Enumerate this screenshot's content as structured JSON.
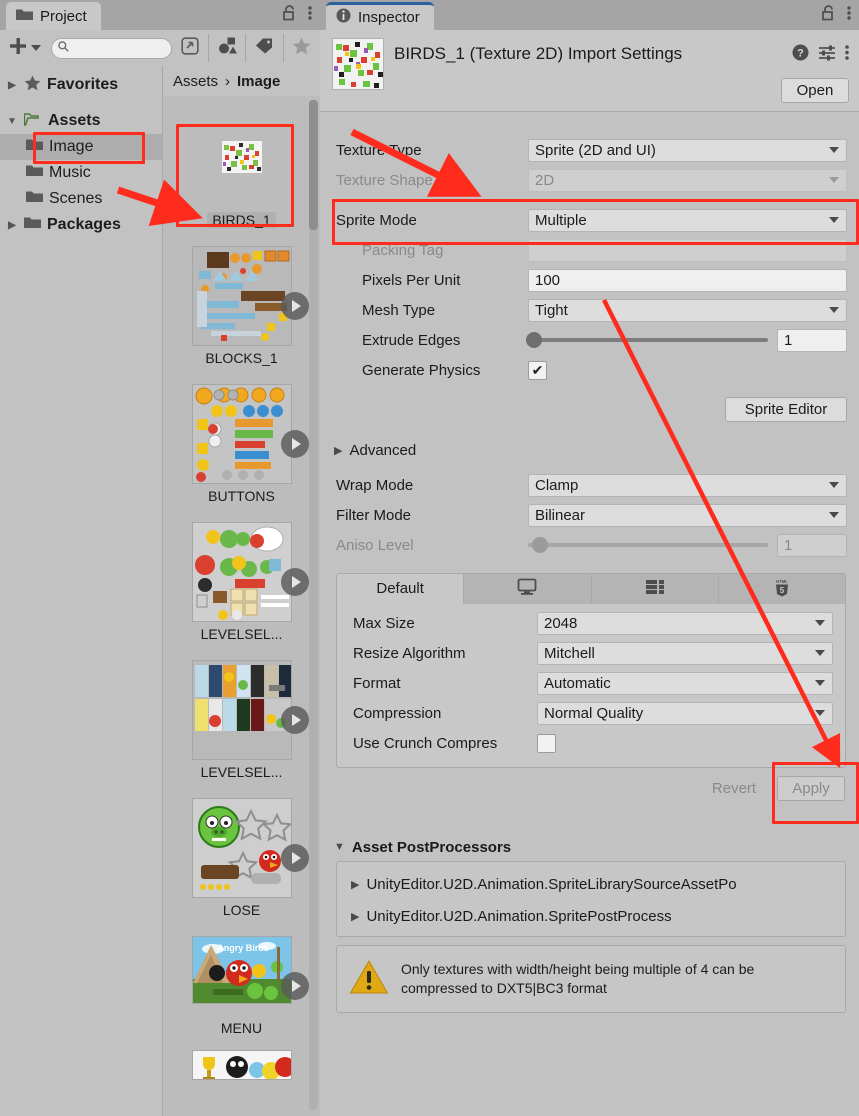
{
  "project_panel": {
    "tab_label": "Project",
    "tab_icon": "folder-icon",
    "lock_icon": "lock-open-icon",
    "menu_icon": "kebab-menu-icon",
    "toolbar": {
      "add_label": "+",
      "add_dropdown_icon": "chevron-down-icon",
      "search_placeholder": "",
      "search_value": "",
      "search_icon": "search-icon",
      "expand_icon": "expand-window-icon",
      "filter_type_icon": "shapes-filter-icon",
      "filter_label_icon": "tag-icon",
      "favorite_icon": "star-icon"
    },
    "tree": [
      {
        "label": "Favorites",
        "icon": "star-icon",
        "arrow": "▶",
        "depth": 0,
        "bold": true,
        "selected": false
      },
      {
        "label": "Assets",
        "icon": "folder-open-icon",
        "arrow": "▼",
        "depth": 0,
        "bold": true,
        "selected": false
      },
      {
        "label": "Image",
        "icon": "folder-icon",
        "arrow": "",
        "depth": 1,
        "bold": false,
        "selected": true
      },
      {
        "label": "Music",
        "icon": "folder-icon",
        "arrow": "",
        "depth": 1,
        "bold": false,
        "selected": false
      },
      {
        "label": "Scenes",
        "icon": "folder-icon",
        "arrow": "",
        "depth": 1,
        "bold": false,
        "selected": false
      },
      {
        "label": "Packages",
        "icon": "folder-icon",
        "arrow": "▶",
        "depth": 0,
        "bold": true,
        "selected": false
      }
    ],
    "breadcrumb": {
      "root": "Assets",
      "separator": "›",
      "current": "Image"
    },
    "assets": [
      {
        "label": "BIRDS_1",
        "selected": true,
        "has_play": false
      },
      {
        "label": "BLOCKS_1",
        "selected": false,
        "has_play": true
      },
      {
        "label": "BUTTONS",
        "selected": false,
        "has_play": true
      },
      {
        "label": "LEVELSEL...",
        "selected": false,
        "has_play": true
      },
      {
        "label": "LEVELSEL...",
        "selected": false,
        "has_play": true
      },
      {
        "label": "LOSE",
        "selected": false,
        "has_play": true
      },
      {
        "label": "MENU",
        "selected": false,
        "has_play": true
      }
    ]
  },
  "inspector": {
    "tab_label": "Inspector",
    "tab_icon": "info-icon",
    "lock_icon": "lock-open-icon",
    "menu_icon": "kebab-menu-icon",
    "title": "BIRDS_1 (Texture 2D) Import Settings",
    "help_icon": "help-circle-icon",
    "presets_icon": "preset-sliders-icon",
    "more_icon": "kebab-menu-icon",
    "open_button": "Open",
    "fields": {
      "texture_type": {
        "label": "Texture Type",
        "value": "Sprite (2D and UI)",
        "dim": false
      },
      "texture_shape": {
        "label": "Texture Shape",
        "value": "2D",
        "dim": true
      },
      "sprite_mode": {
        "label": "Sprite Mode",
        "value": "Multiple",
        "dim": false
      },
      "packing_tag": {
        "label": "Packing Tag",
        "value": "",
        "dim": true
      },
      "pixels_per_unit": {
        "label": "Pixels Per Unit",
        "value": "100",
        "dim": false
      },
      "mesh_type": {
        "label": "Mesh Type",
        "value": "Tight",
        "dim": false
      },
      "extrude_edges": {
        "label": "Extrude Edges",
        "value": "1",
        "dim": false
      },
      "generate_physics": {
        "label": "Generate Physics",
        "checked": true,
        "check_glyph": "✔"
      },
      "sprite_editor_button": "Sprite Editor",
      "advanced_foldout": {
        "label": "Advanced",
        "arrow": "▶"
      },
      "wrap_mode": {
        "label": "Wrap Mode",
        "value": "Clamp",
        "dim": false
      },
      "filter_mode": {
        "label": "Filter Mode",
        "value": "Bilinear",
        "dim": false
      },
      "aniso_level": {
        "label": "Aniso Level",
        "value": "1",
        "dim": true
      }
    },
    "platform_tabs": [
      {
        "label": "Default",
        "icon": "",
        "active": true
      },
      {
        "label": "",
        "icon": "desktop-icon",
        "active": false
      },
      {
        "label": "",
        "icon": "server-rack-icon",
        "active": false
      },
      {
        "label": "",
        "icon": "html5-icon",
        "active": false
      }
    ],
    "platform_settings": {
      "max_size": {
        "label": "Max Size",
        "value": "2048"
      },
      "resize_algorithm": {
        "label": "Resize Algorithm",
        "value": "Mitchell"
      },
      "format": {
        "label": "Format",
        "value": "Automatic"
      },
      "compression": {
        "label": "Compression",
        "value": "Normal Quality"
      },
      "use_crunch": {
        "label": "Use Crunch Compres",
        "checked": false
      }
    },
    "revert_button": "Revert",
    "apply_button": "Apply",
    "postprocessors": {
      "title": "Asset PostProcessors",
      "arrow": "▼",
      "items": [
        {
          "label": "UnityEditor.U2D.Animation.SpriteLibrarySourceAssetPo",
          "arrow": "▶"
        },
        {
          "label": "UnityEditor.U2D.Animation.SpritePostProcess",
          "arrow": "▶"
        }
      ]
    },
    "warning": {
      "icon": "warning-triangle-icon",
      "line1": "Only textures with width/height being multiple of 4 can be",
      "line2": "compressed to DXT5|BC3 format"
    }
  },
  "annotations": {
    "accent_color": "#ff2b1d",
    "highlights": [
      "image-folder-row",
      "birds1-asset-cell",
      "sprite-mode-row",
      "apply-button"
    ],
    "arrows": [
      "arrow-to-texture-shape",
      "arrow-to-scenes-folder",
      "arrow-to-compression"
    ]
  },
  "colors": {
    "panel_bg": "#c2c2c2",
    "header_bg": "#c8c8c8",
    "tabbar_bg": "#a5a5a5",
    "field_bg": "#dddddd",
    "input_bg": "#efefef",
    "selected_row": "#adadad",
    "tab_accent": "#2c5f9e",
    "warning_yellow": "#e0a913"
  }
}
